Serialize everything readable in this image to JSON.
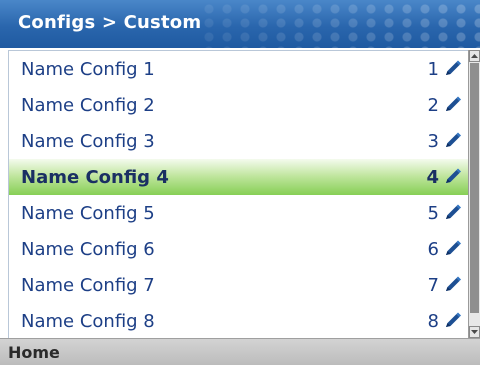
{
  "header": {
    "title": "Configs > Custom"
  },
  "list": {
    "selected_index": 3,
    "rows": [
      {
        "name": "Name Config 1",
        "number": "1"
      },
      {
        "name": "Name Config 2",
        "number": "2"
      },
      {
        "name": "Name Config 3",
        "number": "3"
      },
      {
        "name": "Name Config 4",
        "number": "4"
      },
      {
        "name": "Name Config 5",
        "number": "5"
      },
      {
        "name": "Name Config 6",
        "number": "6"
      },
      {
        "name": "Name Config 7",
        "number": "7"
      },
      {
        "name": "Name Config 8",
        "number": "8"
      }
    ]
  },
  "footer": {
    "home_label": "Home"
  },
  "colors": {
    "header_blue": "#2a66ad",
    "list_text_blue": "#1d3f86",
    "selected_green": "#86cf55"
  },
  "icons": {
    "row_action": "pencil-icon"
  }
}
